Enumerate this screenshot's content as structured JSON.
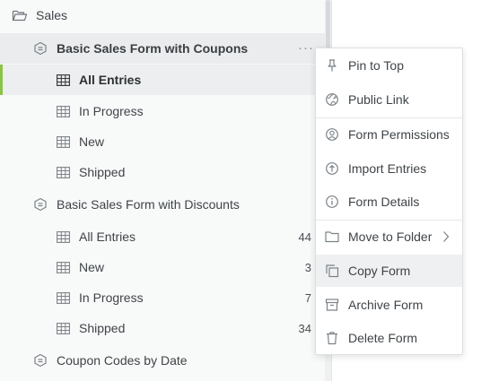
{
  "sidebar": {
    "folder": {
      "label": "Sales",
      "icon": "folder-icon"
    },
    "forms": [
      {
        "label": "Basic Sales Form with Coupons",
        "icon": "form-icon",
        "entries": [
          {
            "label": "All Entries",
            "count": ""
          },
          {
            "label": "In Progress",
            "count": ""
          },
          {
            "label": "New",
            "count": ""
          },
          {
            "label": "Shipped",
            "count": ""
          }
        ]
      },
      {
        "label": "Basic Sales Form with Discounts",
        "icon": "form-icon",
        "entries": [
          {
            "label": "All Entries",
            "count": "44"
          },
          {
            "label": "New",
            "count": "3"
          },
          {
            "label": "In Progress",
            "count": "7"
          },
          {
            "label": "Shipped",
            "count": "34"
          }
        ]
      },
      {
        "label": "Coupon Codes by Date",
        "icon": "form-icon"
      }
    ],
    "more_button": "···"
  },
  "context_menu": {
    "items": [
      {
        "label": "Pin to Top",
        "icon": "pin-icon"
      },
      {
        "label": "Public Link",
        "icon": "globe-link-icon"
      },
      {
        "label": "Form Permissions",
        "icon": "user-permissions-icon"
      },
      {
        "label": "Import Entries",
        "icon": "upload-icon"
      },
      {
        "label": "Form Details",
        "icon": "info-icon"
      },
      {
        "label": "Move to Folder",
        "icon": "folder-icon"
      },
      {
        "label": "Copy Form",
        "icon": "copy-icon"
      },
      {
        "label": "Archive Form",
        "icon": "archive-icon"
      },
      {
        "label": "Delete Form",
        "icon": "trash-icon"
      }
    ]
  },
  "colors": {
    "accent": "#8bc34a",
    "sidebar_bg": "#f8f9f9",
    "selected_bg": "#eceeef",
    "icon": "#7b8287"
  }
}
